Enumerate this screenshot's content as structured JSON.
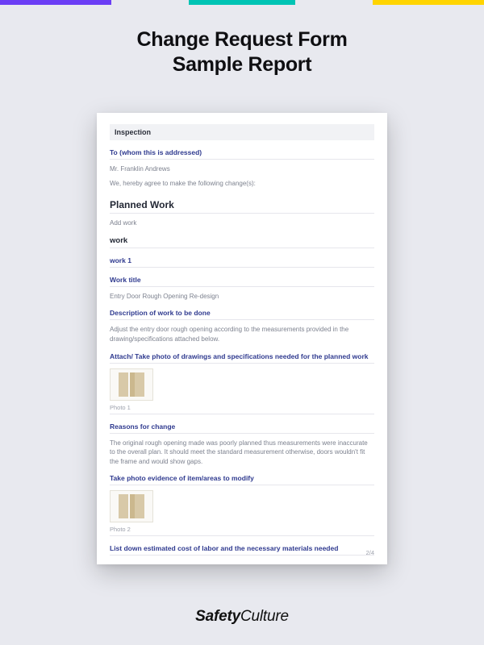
{
  "header": {
    "title_line1": "Change Request Form",
    "title_line2": "Sample Report"
  },
  "doc": {
    "banner": "Inspection",
    "to_label": "To (whom this is addressed)",
    "to_value": "Mr. Franklin Andrews",
    "agree_text": "We, hereby agree to make the following change(s):",
    "section_planned": "Planned Work",
    "add_work": "Add work",
    "work_heading": "work",
    "work1_label": "work 1",
    "work_title_label": "Work title",
    "work_title_value": "Entry Door Rough Opening Re-design",
    "desc_label": "Description of work to be done",
    "desc_value": "Adjust the entry door rough opening according to the measurements provided in the drawing/specifications attached below.",
    "attach_label": "Attach/ Take photo of drawings and specifications needed for the planned work",
    "photo1_caption": "Photo 1",
    "reasons_label": "Reasons for change",
    "reasons_value": "The original rough opening made was poorly planned thus measurements were inaccurate to the overall plan. It should meet the standard measurement otherwise, doors wouldn't fit the frame and would show gaps.",
    "evidence_label": "Take photo evidence of item/areas to modify",
    "photo2_caption": "Photo 2",
    "cost_label": "List down estimated cost of labor and the necessary materials needed",
    "page_num": "2/4"
  },
  "brand": {
    "bold": "Safety",
    "light": "Culture"
  }
}
